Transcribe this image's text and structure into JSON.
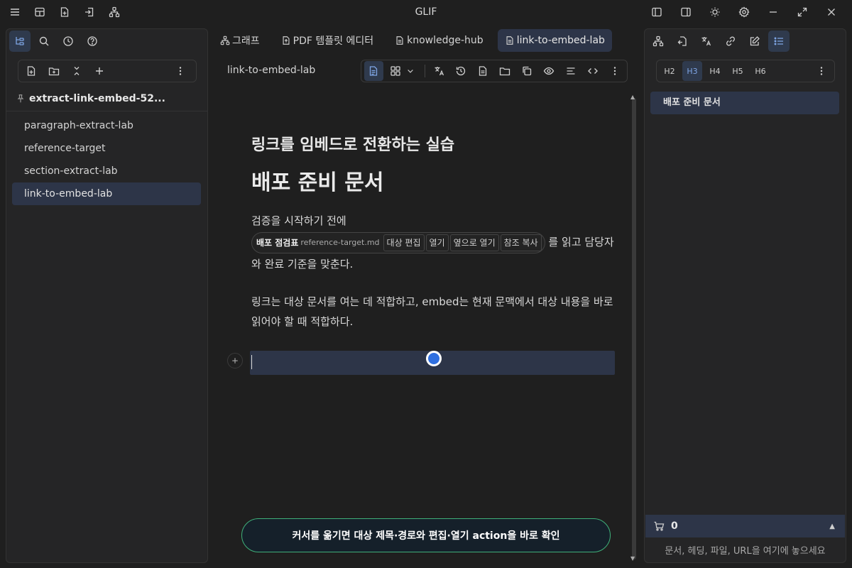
{
  "app": {
    "title": "GLIF"
  },
  "titlebar": {
    "left_icons": [
      "menu-icon",
      "layout-icon",
      "new-file-icon",
      "import-icon",
      "hierarchy-icon"
    ],
    "right_icons": [
      "left-sidebar-icon",
      "right-sidebar-icon",
      "theme-icon",
      "settings-icon",
      "minimize-icon",
      "maximize-icon",
      "close-icon"
    ]
  },
  "left_panel": {
    "toolbar_icons": [
      "file-tree-icon",
      "search-icon",
      "history-icon",
      "help-icon"
    ],
    "action_icons": [
      "new-file-icon",
      "new-folder-icon",
      "collapse-icon",
      "add-icon",
      "more-icon"
    ],
    "pinned_folder": "extract-link-embed-52...",
    "files": [
      {
        "label": "paragraph-extract-lab"
      },
      {
        "label": "reference-target"
      },
      {
        "label": "section-extract-lab"
      },
      {
        "label": "link-to-embed-lab",
        "active": true
      }
    ]
  },
  "tabs": [
    {
      "label": "그래프",
      "icon": "graph-icon"
    },
    {
      "label": "PDF 템플릿 에디터",
      "icon": "pdf-icon"
    },
    {
      "label": "knowledge-hub",
      "icon": "doc-icon"
    },
    {
      "label": "link-to-embed-lab",
      "icon": "doc-icon",
      "active": true
    }
  ],
  "editor": {
    "doc_name": "link-to-embed-lab",
    "toolbar_icons": [
      "document-view-icon",
      "grid-view-icon",
      "chevron-down-icon",
      "translate-icon",
      "history-icon",
      "page-icon",
      "folder-icon",
      "copy-icon",
      "preview-icon",
      "align-icon",
      "code-icon",
      "more-icon"
    ],
    "heading_sub": "링크를 임베드로 전환하는 실습",
    "heading_main": "배포 준비 문서",
    "para1_before": "검증을 시작하기 전에",
    "embed": {
      "title": "배포 점검표",
      "path": "reference-target.md",
      "buttons": [
        "대상 편집",
        "열기",
        "옆으로 열기",
        "참조 복사"
      ]
    },
    "para1_after": " 를 읽고 담당자와 완료 기준을 맞춘다.",
    "para2": "링크는 대상 문서를 여는 데 적합하고, embed는 현재 문맥에서 대상 내용을 바로 읽어야 할 때 적합하다.",
    "hint": "커서를 옮기면 대상 제목·경로와 편집·열기 action을 바로 확인"
  },
  "right_panel": {
    "toolbar_icons": [
      "graph-icon",
      "backlinks-icon",
      "translate-icon",
      "link-icon",
      "edit-icon",
      "outline-icon"
    ],
    "heading_levels": [
      "H2",
      "H3",
      "H4",
      "H5",
      "H6"
    ],
    "active_level": "H3",
    "outline": [
      {
        "label": "배포 준비 문서"
      }
    ],
    "cart_count": "0",
    "drop_hint": "문서, 헤딩, 파일, URL을 여기에 놓으세요"
  }
}
